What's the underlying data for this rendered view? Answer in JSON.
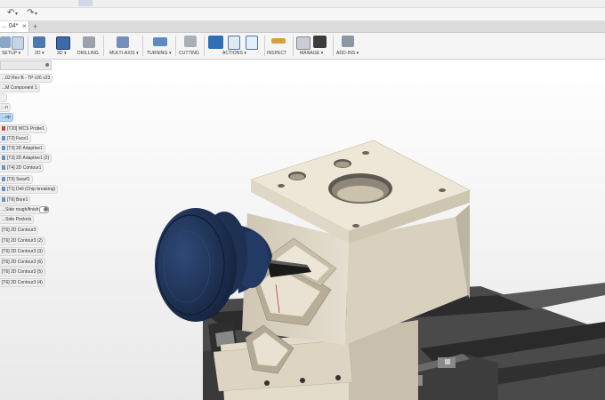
{
  "window": {
    "undo_icon": "undo-arrow-icon",
    "redo_icon": "redo-arrow-icon"
  },
  "document_tab": {
    "label": "... 04*",
    "close": "×",
    "add": "+"
  },
  "ribbon": {
    "groups": [
      {
        "id": "setup",
        "label": "SETUP ▾",
        "icon": "setup-icon"
      },
      {
        "id": "2d",
        "label": "2D ▾",
        "icon": "2d-toolpath-icon"
      },
      {
        "id": "3d",
        "label": "3D ▾",
        "icon": "3d-toolpath-icon"
      },
      {
        "id": "drilling",
        "label": "DRILLING",
        "icon": "drill-icon"
      },
      {
        "id": "multi-axis",
        "label": "MULTI-AXIS ▾",
        "icon": "multi-axis-icon"
      },
      {
        "id": "turning",
        "label": "TURNING ▾",
        "icon": "turning-icon"
      },
      {
        "id": "cutting",
        "label": "CUTTING",
        "icon": "cutting-icon"
      },
      {
        "id": "actions",
        "label": "ACTIONS ▾",
        "icon": "simulate-icon"
      },
      {
        "id": "inspect",
        "label": "INSPECT",
        "icon": "measure-icon"
      },
      {
        "id": "manage",
        "label": "MANAGE ▾",
        "icon": "tool-library-icon"
      },
      {
        "id": "add-ins",
        "label": "ADD-INS ▾",
        "icon": "add-ins-icon"
      }
    ],
    "accent": "#2f6fb3"
  },
  "browser": {
    "items": [
      {
        "label": "...02 Rev B - TP v26 v23"
      },
      {
        "label": "...M Component 1"
      },
      {
        "label": ""
      },
      {
        "label": "...n"
      },
      {
        "label": "...op",
        "selected": true
      },
      {
        "label": "[T20] WCS Probe1"
      },
      {
        "label": "[T2] Face1"
      },
      {
        "label": "[T3] 2D Adaptive1"
      },
      {
        "label": "[T3] 2D Adaptive1 (2)"
      },
      {
        "label": "[T4] 2D Contour1"
      },
      {
        "label": "[T5] Swarf1"
      },
      {
        "label": "[T1] Drill (Chip breaking)"
      },
      {
        "label": "[T6] Bore1"
      },
      {
        "label": "...Side rough/finish"
      },
      {
        "label": "...Side Pockets"
      },
      {
        "label": "[T6] 2D Contour3"
      },
      {
        "label": "[T6] 2D Contour3 (2)"
      },
      {
        "label": "[T6] 2D Contour3 (3)"
      },
      {
        "label": "[T6] 2D Contour3 (6)"
      },
      {
        "label": "[T6] 2D Contour3 (5)"
      },
      {
        "label": "[T6] 2D Contour3 (4)"
      }
    ]
  },
  "viewport": {
    "part_color": "#ebe3d2",
    "tool_color": "#1e3152",
    "table_color": "#3b3b3b"
  }
}
